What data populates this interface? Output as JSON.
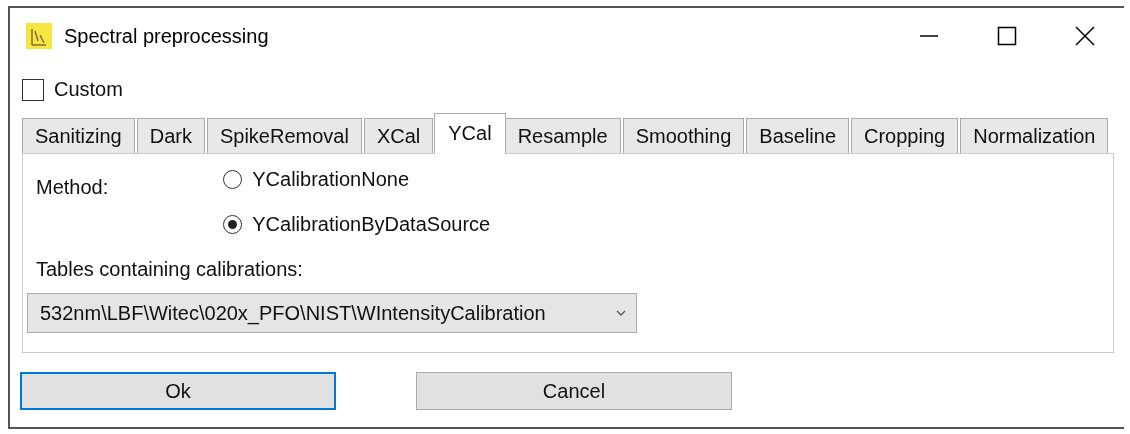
{
  "window": {
    "title": "Spectral preprocessing"
  },
  "custom": {
    "label": "Custom",
    "checked": false
  },
  "tabs": [
    {
      "label": "Sanitizing",
      "selected": false
    },
    {
      "label": "Dark",
      "selected": false
    },
    {
      "label": "SpikeRemoval",
      "selected": false
    },
    {
      "label": "XCal",
      "selected": false
    },
    {
      "label": "YCal",
      "selected": true
    },
    {
      "label": "Resample",
      "selected": false
    },
    {
      "label": "Smoothing",
      "selected": false
    },
    {
      "label": "Baseline",
      "selected": false
    },
    {
      "label": "Cropping",
      "selected": false
    },
    {
      "label": "Normalization",
      "selected": false
    }
  ],
  "method": {
    "label": "Method:",
    "options": [
      {
        "label": "YCalibrationNone",
        "selected": false
      },
      {
        "label": "YCalibrationByDataSource",
        "selected": true
      }
    ]
  },
  "tables": {
    "label": "Tables containing calibrations:",
    "value": "532nm\\LBF\\Witec\\020x_PFO\\NIST\\WIntensityCalibration"
  },
  "buttons": [
    {
      "label": "Ok",
      "default": true
    },
    {
      "label": "Cancel",
      "default": false
    }
  ]
}
